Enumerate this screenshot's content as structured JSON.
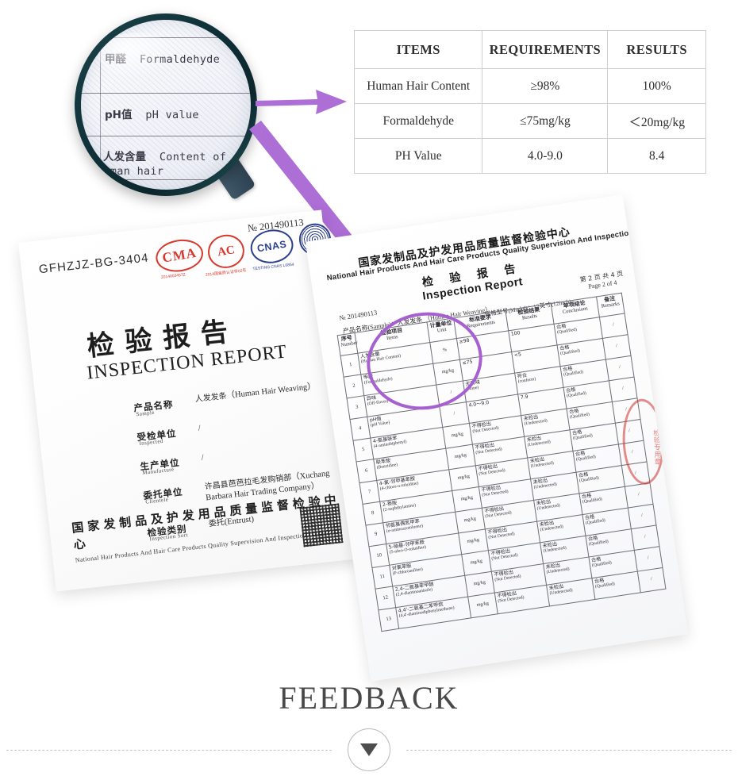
{
  "section": {
    "footer_title": "FEEDBACK",
    "chevron_icon": "chevron-down-icon"
  },
  "accent_colors": {
    "arrow_purple": "#a760d0",
    "circle_purple": "#a760d0",
    "seal_red": "#d8392e",
    "seal_blue": "#2c3f8f",
    "magnifier_rim": "#10313a",
    "magnifier_handle": "#3a5262"
  },
  "results_table": {
    "headers": [
      "ITEMS",
      "REQUIREMENTS",
      "RESULTS"
    ],
    "rows": [
      {
        "item": "Human Hair Content",
        "requirement": "≥98%",
        "result": "100%"
      },
      {
        "item": "Formaldehyde",
        "requirement": "≤75mg/kg",
        "result": "＜20mg/kg"
      },
      {
        "item": "PH Value",
        "requirement": "4.0-9.0",
        "result": "8.4"
      }
    ]
  },
  "magnifier": {
    "rows": [
      {
        "cn": "甲醛",
        "en": "Formaldehyde"
      },
      {
        "cn": "pH值",
        "en": "pH value"
      },
      {
        "cn": "人发含量",
        "en": "Content of"
      },
      {
        "cn": "",
        "en": "human hair"
      }
    ]
  },
  "left_doc": {
    "code": "GFHZJZ-BG-3404",
    "number": "№ 201490113",
    "seals": [
      {
        "name": "cma-seal",
        "label": "CMA",
        "sub": "2014003457Z"
      },
      {
        "name": "cal-seal",
        "label": "AC",
        "sub": "2014国金质认证字02号"
      },
      {
        "name": "cnas-seal",
        "label": "CNAS",
        "sub": "TESTING CNAS L0854"
      },
      {
        "name": "ilac-mra-seal",
        "label": "ILAC-MRA",
        "sub": ""
      }
    ],
    "title_cn": "检验报告",
    "title_en": "INSPECTION REPORT",
    "fields": [
      {
        "label_cn": "产品名称",
        "label_en": "Sample",
        "value_cn": "人发发条",
        "value_en": "（Human Hair Weaving）"
      },
      {
        "label_cn": "受检单位",
        "label_en": "Inspected",
        "value_cn": "",
        "value_en": "/"
      },
      {
        "label_cn": "生产单位",
        "label_en": "Manufacture",
        "value_cn": "",
        "value_en": "/"
      },
      {
        "label_cn": "委托单位",
        "label_en": "Clientele",
        "value_cn": "许昌县芭芭拉毛发购销部",
        "value_en": "（Xuchang Barbara Hair Trading Company）"
      },
      {
        "label_cn": "检验类别",
        "label_en": "Inspection Sort",
        "value_cn": "委托",
        "value_en": "(Entrust)"
      }
    ],
    "footer_cn": "国家发制品及护发用品质量监督检验中心",
    "footer_en": "National Hair Products And Hair Care Products Quality Supervision And Inspection Center",
    "qr_name": "qr-code"
  },
  "right_doc": {
    "org_cn": "国家发制品及护发用品质量监督检验中心",
    "org_en": "National Hair Products And Hair Care Products Quality Supervision And Inspection Center",
    "title_cn": "检 验 报 告",
    "title_en": "Inspection Report",
    "number": "№ 201490113",
    "sample": "产品名称(Sample)：人发发条 （Human Hair Weaving）",
    "model": "规格型号(Model)：12英寸(12inch)",
    "page_cn": "第 2 页 共 4 页",
    "page_en": "Page    2    of    4",
    "stamp_text": "检验专用章",
    "table_headers": [
      {
        "cn": "序号",
        "en": "Number"
      },
      {
        "cn": "检验项目",
        "en": "Items"
      },
      {
        "cn": "计量单位",
        "en": "Unit"
      },
      {
        "cn": "标准要求",
        "en": "Requirements"
      },
      {
        "cn": "检验结果",
        "en": "Results"
      },
      {
        "cn": "单项结论",
        "en": "Conclusions"
      },
      {
        "cn": "备注",
        "en": "Remarks"
      }
    ],
    "table_rows": [
      {
        "no": "1",
        "item_cn": "人发含量",
        "item_en": "(Human Hair Content)",
        "unit": "%",
        "req_cn": "≥98",
        "req_en": "",
        "res_cn": "100",
        "res_en": "",
        "con_cn": "合格",
        "con_en": "(Qualified)",
        "rem": "/"
      },
      {
        "no": "2",
        "item_cn": "甲醛",
        "item_en": "(Formaldehyde)",
        "unit": "mg/kg",
        "req_cn": "≤75",
        "req_en": "",
        "res_cn": "<5",
        "res_en": "",
        "con_cn": "合格",
        "con_en": "(Qualified)",
        "rem": "/"
      },
      {
        "no": "3",
        "item_cn": "异味",
        "item_en": "(Off-flavor)",
        "unit": "/",
        "req_cn": "无异味",
        "req_en": "(None)",
        "res_cn": "符合",
        "res_en": "(conform)",
        "con_cn": "合格",
        "con_en": "(Qualified)",
        "rem": "/"
      },
      {
        "no": "4",
        "item_cn": "pH值",
        "item_en": "(pH Value)",
        "unit": "/",
        "req_cn": "4.0～9.0",
        "req_en": "",
        "res_cn": "7.9",
        "res_en": "",
        "con_cn": "合格",
        "con_en": "(Qualified)",
        "rem": "/"
      },
      {
        "no": "5",
        "item_cn": "4-氨基联苯",
        "item_en": "(4-aminobiphenyl)",
        "unit": "mg/kg",
        "req_cn": "不得检出",
        "req_en": "(Not Detected)",
        "res_cn": "未检出",
        "res_en": "(Undetected)",
        "con_cn": "合格",
        "con_en": "(Qualified)",
        "rem": "/"
      },
      {
        "no": "6",
        "item_cn": "联苯胺",
        "item_en": "(Benzidine)",
        "unit": "mg/kg",
        "req_cn": "不得检出",
        "req_en": "(Not Detected)",
        "res_cn": "未检出",
        "res_en": "(Undetected)",
        "con_cn": "合格",
        "con_en": "(Qualified)",
        "rem": "/"
      },
      {
        "no": "7",
        "item_cn": "4-氯-邻甲基苯胺",
        "item_en": "(4-chloro-o-toluidine)",
        "unit": "mg/kg",
        "req_cn": "不得检出",
        "req_en": "(Not Detected)",
        "res_cn": "未检出",
        "res_en": "(Undetected)",
        "con_cn": "合格",
        "con_en": "(Qualified)",
        "rem": "/"
      },
      {
        "no": "8",
        "item_cn": "2-萘胺",
        "item_en": "(2-naphthylamine)",
        "unit": "mg/kg",
        "req_cn": "不得检出",
        "req_en": "(Not Detected)",
        "res_cn": "未检出",
        "res_en": "(Undetected)",
        "con_cn": "合格",
        "con_en": "(Qualified)",
        "rem": "/"
      },
      {
        "no": "9",
        "item_cn": "邻氨基偶氮甲苯",
        "item_en": "(o-aminoazotoluene)",
        "unit": "mg/kg",
        "req_cn": "不得检出",
        "req_en": "(Not Detected)",
        "res_cn": "未检出",
        "res_en": "(Undetected)",
        "con_cn": "合格",
        "con_en": "(Qualified)",
        "rem": "/"
      },
      {
        "no": "10",
        "item_cn": "5-硝基-邻甲苯胺",
        "item_en": "(5-nitro-O-toluidine)",
        "unit": "mg/kg",
        "req_cn": "不得检出",
        "req_en": "(Not Detected)",
        "res_cn": "未检出",
        "res_en": "(Undetected)",
        "con_cn": "合格",
        "con_en": "(Qualified)",
        "rem": "/"
      },
      {
        "no": "11",
        "item_cn": "对氯苯胺",
        "item_en": "(P-chloroaniline)",
        "unit": "mg/kg",
        "req_cn": "不得检出",
        "req_en": "(Not Detected)",
        "res_cn": "未检出",
        "res_en": "(Undetected)",
        "con_cn": "合格",
        "con_en": "(Qualified)",
        "rem": "/"
      },
      {
        "no": "12",
        "item_cn": "2,4-二氨基苯甲醚",
        "item_en": "(2,4-diaminoanisole)",
        "unit": "mg/kg",
        "req_cn": "不得检出",
        "req_en": "(Not Detected)",
        "res_cn": "未检出",
        "res_en": "(Undetected)",
        "con_cn": "合格",
        "con_en": "(Qualified)",
        "rem": "/"
      },
      {
        "no": "13",
        "item_cn": "4,4'-二氨基二苯甲烷",
        "item_en": "(4,4'-diaminodiphenylmethane)",
        "unit": "mg/kg",
        "req_cn": "不得检出",
        "req_en": "(Not Detected)",
        "res_cn": "未检出",
        "res_en": "(Undetected)",
        "con_cn": "合格",
        "con_en": "(Qualified)",
        "rem": "/"
      }
    ]
  }
}
